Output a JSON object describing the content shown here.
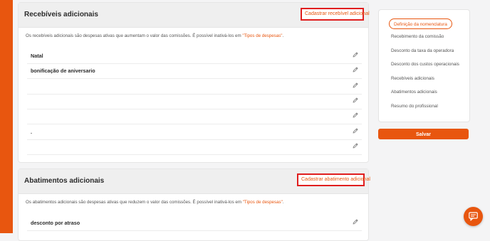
{
  "receivables": {
    "title": "Recebíveis adicionais",
    "add_button": "Cadastrar recebível adicional",
    "description_prefix": "Os recebíveis adicionais são despesas ativas que aumentam o valor das comissões. É possível inativá-los em ",
    "description_link": "\"Tipos de despesas\"",
    "description_suffix": ".",
    "rows": [
      "Natal",
      "bonificação de aniversario",
      "",
      "",
      "",
      ".",
      ""
    ]
  },
  "deductions": {
    "title": "Abatimentos adicionais",
    "add_button": "Cadastrar abatimento adicional",
    "description_prefix": "Os abatimentos adicionais são despesas ativas que reduzem o valor das comissões. É possível inativá-los em ",
    "description_link": "\"Tipos de despesas\"",
    "description_suffix": ".",
    "rows": [
      "desconto por atraso"
    ]
  },
  "nav": {
    "items": [
      "Definição da nomenclatura",
      "Recebimento da comissão",
      "Desconto da taxa da operadora",
      "Desconto dos custos operacionais",
      "Recebíveis adicionais",
      "Abatimentos adicionais",
      "Resumo do profissional"
    ],
    "active_index": 0
  },
  "save_button": "Salvar",
  "icons": {
    "edit": "pencil-icon",
    "chat": "chat-icon"
  },
  "colors": {
    "accent": "#e8560f",
    "highlight_border": "#e01e1e"
  }
}
